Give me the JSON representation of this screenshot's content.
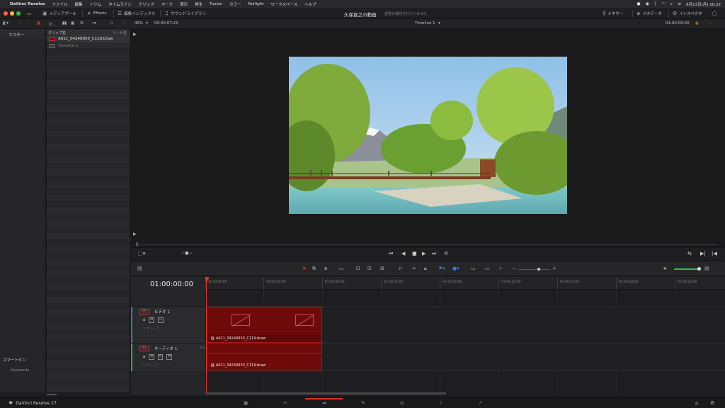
{
  "menubar": {
    "apple": "",
    "items": [
      "DaVinci Resolve",
      "ファイル",
      "編集",
      "トリム",
      "タイムライン",
      "クリップ",
      "マーク",
      "表示",
      "再生",
      "Fusion",
      "カラー",
      "Fairlight",
      "ワークスペース",
      "ヘルプ"
    ],
    "datetime": "6月13日(月) 20:22"
  },
  "toolbar": {
    "media_pool": "メディアプール",
    "effects": "Effects",
    "edit_index": "編集インデックス",
    "sound_library": "サウンドライブラリ",
    "project_title": "久保直之の動画",
    "save_status": "変更が保存されていません",
    "mixer": "ミキサー",
    "metadata": "メタデータ",
    "inspector": "インスペクタ"
  },
  "subtoolbar": {
    "bin_label": "マ...",
    "zoom": "45%",
    "duration": "00:00:07:23",
    "timeline_name": "Timeline 1",
    "timecode": "01:00:00:00"
  },
  "bins": {
    "master": "マスター",
    "smart_bins": "スマートビン",
    "keywords": "Keywords"
  },
  "clips": {
    "header_name": "クリップ名",
    "header_reel": "リール名",
    "items": [
      {
        "name": "A011_04240950_C119.braw"
      },
      {
        "name": "Timeline 1"
      }
    ]
  },
  "timeline": {
    "timecode": "01:00:00:00",
    "ruler": [
      "01:00:00:00",
      "01:00:04:00",
      "01:00:08:00",
      "01:00:12:00",
      "01:00:16:00",
      "01:00:20:00",
      "01:00:24:00",
      "01:00:28:00",
      "01:00:32:00"
    ],
    "video_track": {
      "tag": "V1",
      "name": "ビデオ 1",
      "clips": "1 クリップ",
      "clip_name": "A011_04240950_C119.braw"
    },
    "audio_track": {
      "tag": "A1",
      "name": "オーディオ 1",
      "level": "2.0",
      "clips": "1 クリップ",
      "clip_name": "A011_04240950_C119.braw"
    }
  },
  "bottombar": {
    "brand": "DaVinci Resolve 17",
    "active_page": "edit"
  },
  "colors": {
    "accent_red": "#e0302a",
    "clip_red": "#6e0a0a",
    "audio_green": "#2ec04a"
  }
}
